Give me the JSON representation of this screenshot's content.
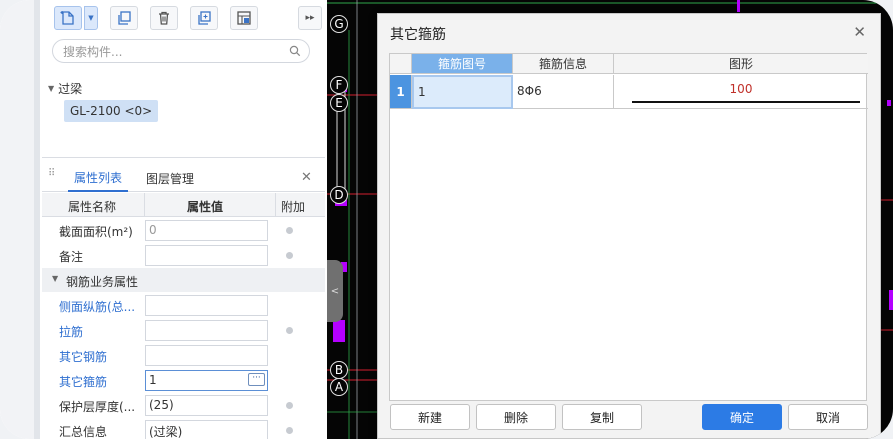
{
  "left_panel": {
    "search": {
      "placeholder": "搜索构件..."
    },
    "tree": {
      "group_label": "过梁",
      "items": [
        {
          "label": "GL-2100 <0>"
        }
      ]
    },
    "properties": {
      "tabs": [
        {
          "label": "属性列表"
        },
        {
          "label": "图层管理"
        }
      ],
      "columns": {
        "name": "属性名称",
        "value": "属性值",
        "extra": "附加"
      },
      "rows_top": [
        {
          "name": "截面面积(m²)",
          "value": "0"
        },
        {
          "name": "备注",
          "value": ""
        }
      ],
      "group": "钢筋业务属性",
      "rows_group": [
        {
          "name": "侧面纵筋(总...",
          "value": ""
        },
        {
          "name": "拉筋",
          "value": ""
        },
        {
          "name": "其它钢筋",
          "value": ""
        },
        {
          "name": "其它箍筋",
          "value": "1"
        },
        {
          "name": "保护层厚度(...",
          "value": "(25)"
        },
        {
          "name": "汇总信息",
          "value": "(过梁)"
        }
      ],
      "more_button": "···"
    }
  },
  "cad": {
    "axis_labels": [
      "G",
      "F",
      "E",
      "D",
      "B",
      "A"
    ],
    "collapse_glyph": "<"
  },
  "dialog": {
    "title": "其它箍筋",
    "columns": [
      "箍筋图号",
      "箍筋信息",
      "图形"
    ],
    "rows": [
      {
        "index": "1",
        "code": "1",
        "info": "8Φ6",
        "shape_value": "100"
      }
    ],
    "buttons": {
      "new": "新建",
      "delete": "删除",
      "copy": "复制",
      "ok": "确定",
      "cancel": "取消"
    }
  },
  "colors": {
    "accent": "#2c7be5",
    "selected_header": "#7ab1ea",
    "row_index": "#4c94e0",
    "shape_value_red": "#c0302a",
    "cad_background": "#050505",
    "cad_magenta": "#b400ff",
    "cad_red": "#d21f2f",
    "cad_green": "#2ea84a"
  },
  "icons": [
    "new-component-icon",
    "copy-icon",
    "delete-icon",
    "duplicate-icon",
    "layer-copy-icon",
    "double-arrow-icon",
    "search-icon",
    "close-icon",
    "grip-icon"
  ]
}
